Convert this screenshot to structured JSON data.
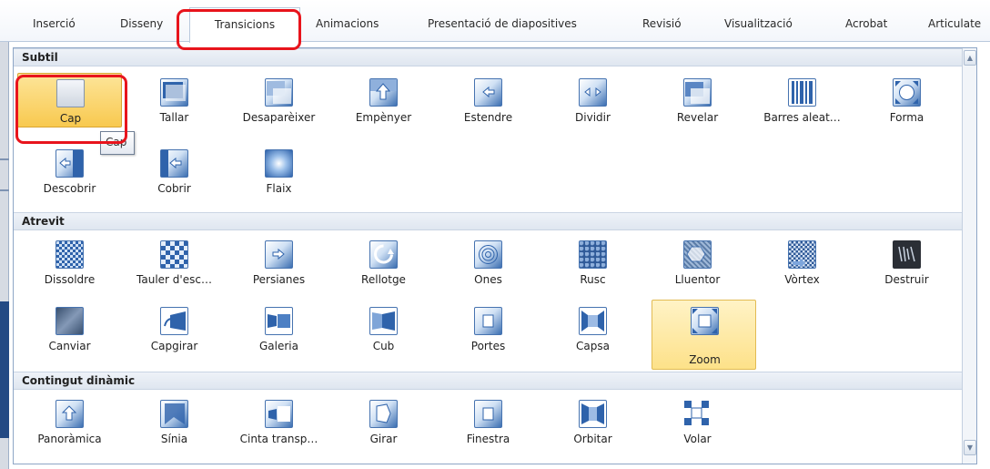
{
  "ribbon": {
    "tabs": [
      {
        "label": "Inserció",
        "active": false
      },
      {
        "label": "Disseny",
        "active": false
      },
      {
        "label": "Transicions",
        "active": true
      },
      {
        "label": "Animacions",
        "active": false
      },
      {
        "label": "Presentació de diapositives",
        "active": false
      },
      {
        "label": "Revisió",
        "active": false
      },
      {
        "label": "Visualització",
        "active": false
      },
      {
        "label": "Acrobat",
        "active": false
      },
      {
        "label": "Articulate",
        "active": false
      }
    ]
  },
  "gallery": {
    "sections": [
      {
        "title": "Subtil",
        "items": [
          {
            "label": "Cap",
            "icon": "none-transition-icon",
            "state": "selected"
          },
          {
            "label": "Tallar",
            "icon": "cut-transition-icon"
          },
          {
            "label": "Desaparèixer",
            "icon": "fade-transition-icon"
          },
          {
            "label": "Empènyer",
            "icon": "push-transition-icon"
          },
          {
            "label": "Estendre",
            "icon": "wipe-transition-icon"
          },
          {
            "label": "Dividir",
            "icon": "split-transition-icon"
          },
          {
            "label": "Revelar",
            "icon": "reveal-transition-icon"
          },
          {
            "label": "Barres aleat…",
            "icon": "random-bars-transition-icon"
          },
          {
            "label": "Forma",
            "icon": "shape-transition-icon"
          },
          {
            "label": "Descobrir",
            "icon": "uncover-transition-icon"
          },
          {
            "label": "Cobrir",
            "icon": "cover-transition-icon"
          },
          {
            "label": "Flaix",
            "icon": "flash-transition-icon"
          }
        ]
      },
      {
        "title": "Atrevit",
        "items": [
          {
            "label": "Dissoldre",
            "icon": "dissolve-transition-icon"
          },
          {
            "label": "Tauler d'esc…",
            "icon": "checkerboard-transition-icon"
          },
          {
            "label": "Persianes",
            "icon": "blinds-transition-icon"
          },
          {
            "label": "Rellotge",
            "icon": "clock-transition-icon"
          },
          {
            "label": "Ones",
            "icon": "ripple-transition-icon"
          },
          {
            "label": "Rusc",
            "icon": "honeycomb-transition-icon"
          },
          {
            "label": "Lluentor",
            "icon": "glitter-transition-icon"
          },
          {
            "label": "Vòrtex",
            "icon": "vortex-transition-icon"
          },
          {
            "label": "Destruir",
            "icon": "shred-transition-icon"
          },
          {
            "label": "Canviar",
            "icon": "switch-transition-icon"
          },
          {
            "label": "Capgirar",
            "icon": "flip-transition-icon"
          },
          {
            "label": "Galeria",
            "icon": "gallery-transition-icon"
          },
          {
            "label": "Cub",
            "icon": "cube-transition-icon"
          },
          {
            "label": "Portes",
            "icon": "doors-transition-icon"
          },
          {
            "label": "Capsa",
            "icon": "box-transition-icon"
          },
          {
            "label": "Zoom",
            "icon": "zoom-transition-icon",
            "state": "hot"
          }
        ]
      },
      {
        "title": "Contingut dinàmic",
        "items": [
          {
            "label": "Panoràmica",
            "icon": "pan-transition-icon"
          },
          {
            "label": "Sínia",
            "icon": "ferris-wheel-transition-icon"
          },
          {
            "label": "Cinta transp…",
            "icon": "conveyor-transition-icon"
          },
          {
            "label": "Girar",
            "icon": "rotate-transition-icon"
          },
          {
            "label": "Finestra",
            "icon": "window-transition-icon"
          },
          {
            "label": "Orbitar",
            "icon": "orbit-transition-icon"
          },
          {
            "label": "Volar",
            "icon": "fly-through-transition-icon"
          }
        ]
      }
    ],
    "tooltip": "Cap"
  },
  "colors": {
    "accent_red": "#e8141c",
    "selected_fill": "#f8c94f",
    "icon_blue": "#3c6fb2",
    "header_fill": "#dfe6f0"
  }
}
